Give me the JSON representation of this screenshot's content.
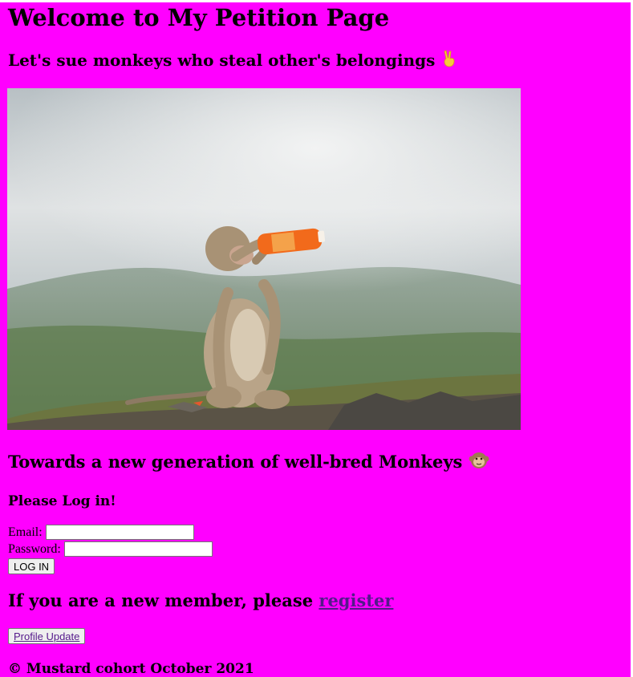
{
  "header": {
    "title": "Welcome to My Petition Page",
    "subtitle": "Let's sue monkeys who steal other's belongings",
    "subtitle_emoji": "victory-hand-emoji"
  },
  "image": {
    "alt": "monkey drinking from an orange soda bottle"
  },
  "tagline": {
    "text": "Towards a new generation of well-bred Monkeys",
    "emoji": "monkey-emoji"
  },
  "login": {
    "heading": "Please Log in!",
    "email_label": "Email:",
    "email_value": "",
    "password_label": "Password:",
    "password_value": "",
    "button_label": "LOG IN"
  },
  "register": {
    "prefix": "If you are a new member, please ",
    "link_label": "register"
  },
  "profile_button": "Profile Update",
  "footer": {
    "text": "© Mustard cohort October 2021"
  },
  "colors": {
    "page_background": "#ff00ff",
    "link": "#551a8b",
    "button_background": "#efefef"
  }
}
